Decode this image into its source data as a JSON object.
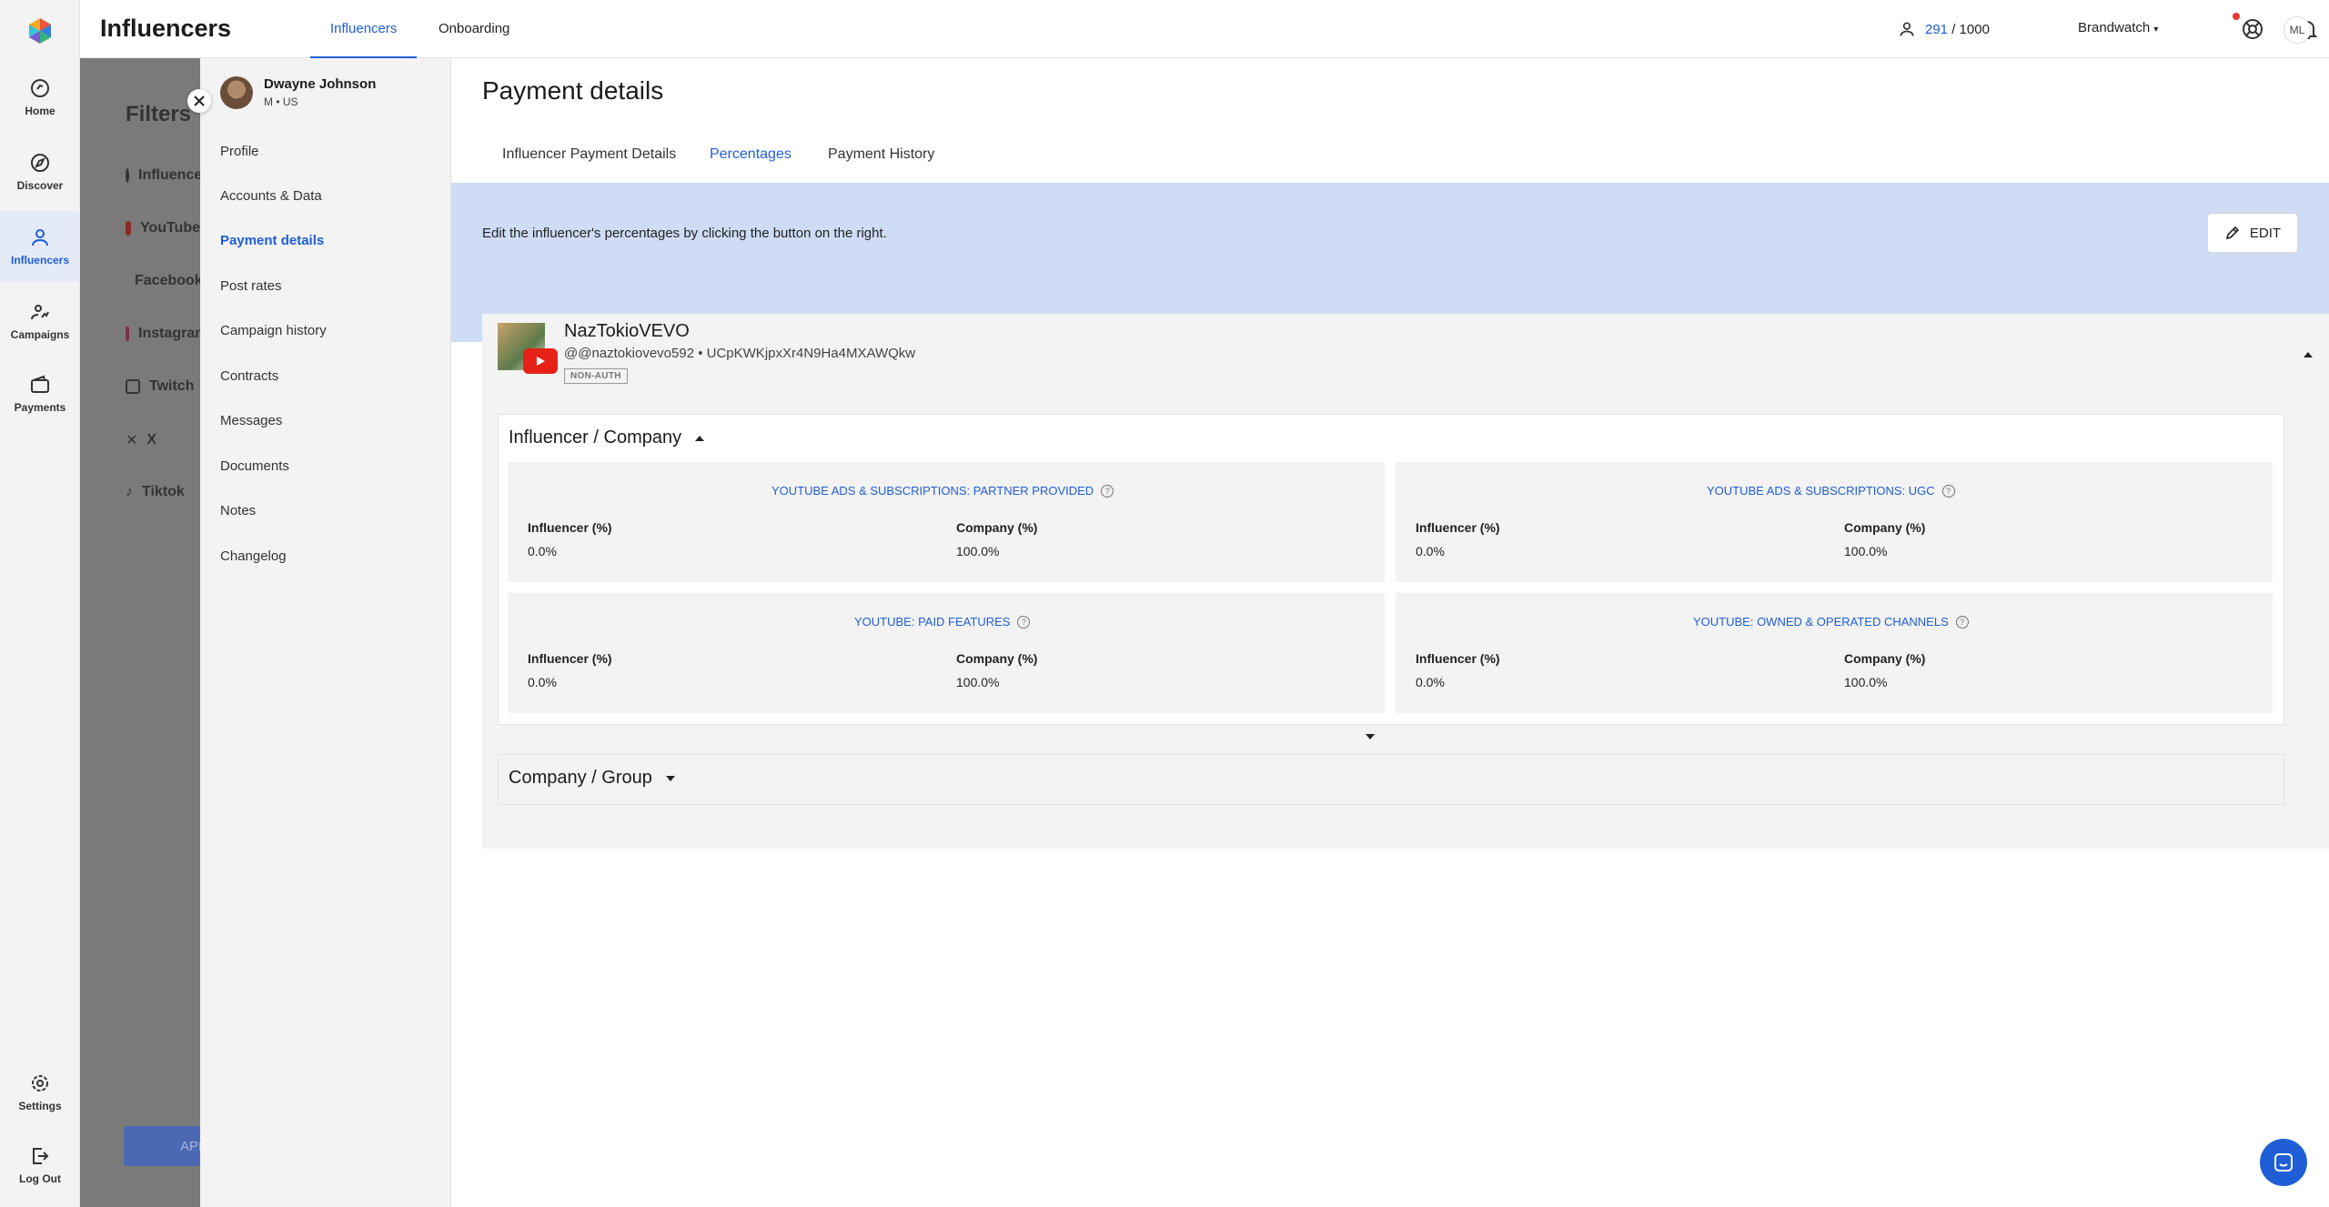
{
  "app": {
    "title": "Influencers",
    "top_tabs": [
      {
        "label": "Influencers"
      },
      {
        "label": "Onboarding"
      }
    ],
    "counter": {
      "used": "291",
      "sep": " / ",
      "total": "1000"
    },
    "brand": "Brandwatch",
    "user_initials": "ML",
    "accent": "#1f5ed6"
  },
  "rail": {
    "items": [
      {
        "label": "Home",
        "icon": "home-icon"
      },
      {
        "label": "Discover",
        "icon": "discover-icon"
      },
      {
        "label": "Influencers",
        "icon": "person-icon"
      },
      {
        "label": "Campaigns",
        "icon": "campaigns-icon"
      },
      {
        "label": "Payments",
        "icon": "wallet-icon"
      },
      {
        "label": "Settings",
        "icon": "gear-icon"
      },
      {
        "label": "Log Out",
        "icon": "logout-icon"
      }
    ]
  },
  "filters": {
    "title": "Filters",
    "rows": [
      "Influencer",
      "YouTube",
      "Facebook",
      "Instagram",
      "Twitch",
      "X",
      "Tiktok"
    ],
    "apply": "APPLY"
  },
  "profile": {
    "name": "Dwayne Johnson",
    "gender": "M",
    "country": "US"
  },
  "side_nav": [
    "Profile",
    "Accounts & Data",
    "Payment details",
    "Post rates",
    "Campaign history",
    "Contracts",
    "Messages",
    "Documents",
    "Notes",
    "Changelog"
  ],
  "main": {
    "title": "Payment details",
    "tabs": [
      "Influencer Payment Details",
      "Percentages",
      "Payment History"
    ],
    "banner_text": "Edit the influencer's percentages by clicking the button on the right.",
    "edit_label": "EDIT"
  },
  "account": {
    "name": "NazTokioVEVO",
    "handle": "@@naztokiovevo592",
    "channel_id": "UCpKWKjpxXr4N9Ha4MXAWQkw",
    "badge": "NON-AUTH"
  },
  "influencer_company": {
    "title": "Influencer / Company",
    "influencer_label": "Influencer (%)",
    "company_label": "Company (%)",
    "cells": [
      {
        "heading": "YOUTUBE ADS & SUBSCRIPTIONS: PARTNER PROVIDED",
        "influencer": "0.0%",
        "company": "100.0%"
      },
      {
        "heading": "YOUTUBE ADS & SUBSCRIPTIONS: UGC",
        "influencer": "0.0%",
        "company": "100.0%"
      },
      {
        "heading": "YOUTUBE: PAID FEATURES",
        "influencer": "0.0%",
        "company": "100.0%"
      },
      {
        "heading": "YOUTUBE: OWNED & OPERATED CHANNELS",
        "influencer": "0.0%",
        "company": "100.0%"
      }
    ]
  },
  "company_group": {
    "title": "Company / Group"
  }
}
